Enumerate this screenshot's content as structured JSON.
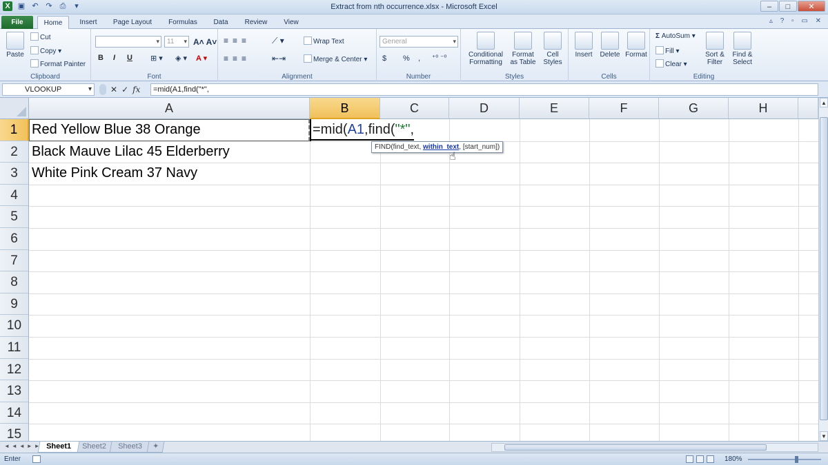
{
  "window": {
    "title": "Extract from nth occurrence.xlsx - Microsoft Excel",
    "controls": [
      "–",
      "□",
      "✕"
    ]
  },
  "ribbon_tabs": [
    "File",
    "Home",
    "Insert",
    "Page Layout",
    "Formulas",
    "Data",
    "Review",
    "View"
  ],
  "ribbon": {
    "clipboard": {
      "label": "Clipboard",
      "paste": "Paste",
      "cut": "Cut",
      "copy": "Copy",
      "format_painter": "Format Painter"
    },
    "font": {
      "label": "Font",
      "font_name": "",
      "font_size": "11",
      "bold": "B",
      "italic": "I",
      "underline": "U"
    },
    "alignment": {
      "label": "Alignment",
      "wrap_text": "Wrap Text",
      "merge_center": "Merge & Center"
    },
    "number": {
      "label": "Number",
      "format": "General",
      "currency": "$",
      "percent": "%",
      "comma": ","
    },
    "styles": {
      "label": "Styles",
      "conditional_formatting": "Conditional Formatting",
      "format_as_table": "Format as Table",
      "cell_styles": "Cell Styles"
    },
    "cells": {
      "label": "Cells",
      "insert": "Insert",
      "delete": "Delete",
      "format": "Format"
    },
    "editing": {
      "label": "Editing",
      "autosum": "AutoSum",
      "fill": "Fill",
      "clear": "Clear",
      "sort_filter": "Sort & Filter",
      "find_select": "Find & Select"
    }
  },
  "formula_bar": {
    "name_box": "VLOOKUP",
    "formula": "=mid(A1,find(\"*\",",
    "cancel": "✕",
    "enter": "✓",
    "fx": "fx"
  },
  "columns": [
    "A",
    "B",
    "C",
    "D",
    "E",
    "F",
    "G",
    "H"
  ],
  "rows": [
    "1",
    "2",
    "3",
    "4",
    "5",
    "6",
    "7",
    "8",
    "9",
    "10",
    "11",
    "12",
    "13",
    "14",
    "15"
  ],
  "cells": {
    "A1": "Red Yellow Blue 38 Orange",
    "A2": "Black Mauve Lilac 45 Elderberry",
    "A3": "White Pink Cream 37 Navy"
  },
  "editing_cell": {
    "prefix": "=mid(",
    "ref": "A1",
    "mid": ",find(",
    "str": "\"*\"",
    "suffix": ","
  },
  "tooltip": {
    "pre": "FIND(find_text, ",
    "bold": "within_text",
    "post": ", [start_num])"
  },
  "sheets": [
    "Sheet1",
    "Sheet2",
    "Sheet3"
  ],
  "status": {
    "mode": "Enter",
    "zoom": "180%"
  },
  "colors": {
    "file_tab": "#1f6b2f",
    "selected_header": "#f1c15b",
    "ref_blue": "#1f3fa0",
    "string_green": "#1e7b34"
  }
}
